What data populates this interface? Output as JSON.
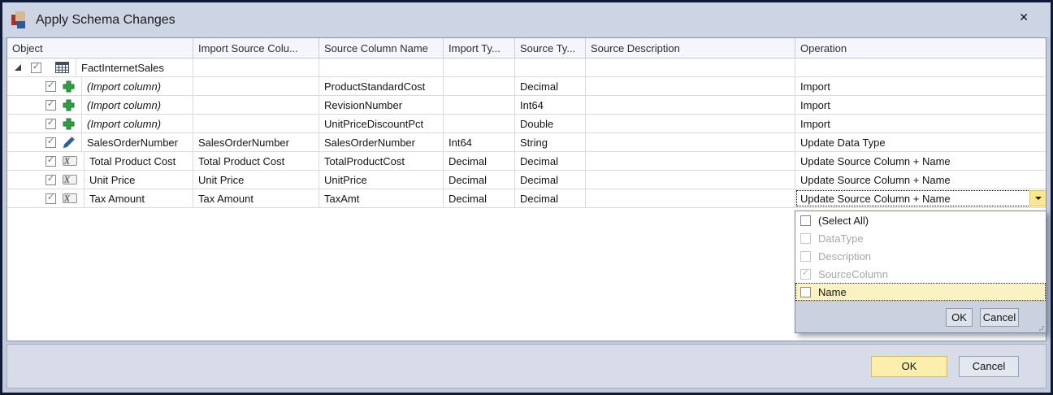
{
  "window": {
    "title": "Apply Schema Changes",
    "close_glyph": "✕"
  },
  "grid": {
    "columns": [
      {
        "label": "Object"
      },
      {
        "label": "Import Source Colu..."
      },
      {
        "label": "Source Column Name"
      },
      {
        "label": "Import Ty..."
      },
      {
        "label": "Source Ty..."
      },
      {
        "label": "Source Description"
      },
      {
        "label": "Operation"
      }
    ],
    "rows": [
      {
        "object": "FactInternetSales",
        "icon": "table-icon",
        "level": 0,
        "expanded": true,
        "checked": true,
        "import_source_column": "",
        "source_column_name": "",
        "import_type": "",
        "source_type": "",
        "source_description": "",
        "operation": ""
      },
      {
        "object": "(Import column)",
        "icon": "add-icon",
        "italic": true,
        "level": 1,
        "checked": true,
        "import_source_column": "",
        "source_column_name": "ProductStandardCost",
        "import_type": "",
        "source_type": "Decimal",
        "source_description": "",
        "operation": "Import"
      },
      {
        "object": "(Import column)",
        "icon": "add-icon",
        "italic": true,
        "level": 1,
        "checked": true,
        "import_source_column": "",
        "source_column_name": "RevisionNumber",
        "import_type": "",
        "source_type": "Int64",
        "source_description": "",
        "operation": "Import"
      },
      {
        "object": "(Import column)",
        "icon": "add-icon",
        "italic": true,
        "level": 1,
        "checked": true,
        "import_source_column": "",
        "source_column_name": "UnitPriceDiscountPct",
        "import_type": "",
        "source_type": "Double",
        "source_description": "",
        "operation": "Import"
      },
      {
        "object": "SalesOrderNumber",
        "icon": "edit-icon",
        "level": 1,
        "checked": true,
        "import_source_column": "SalesOrderNumber",
        "source_column_name": "SalesOrderNumber",
        "import_type": "Int64",
        "source_type": "String",
        "source_description": "",
        "operation": "Update Data Type"
      },
      {
        "object": "Total Product Cost",
        "icon": "column-icon",
        "level": 1,
        "checked": true,
        "import_source_column": "Total Product Cost",
        "source_column_name": "TotalProductCost",
        "import_type": "Decimal",
        "source_type": "Decimal",
        "source_description": "",
        "operation": "Update Source Column + Name"
      },
      {
        "object": "Unit Price",
        "icon": "column-icon",
        "level": 1,
        "checked": true,
        "import_source_column": "Unit Price",
        "source_column_name": "UnitPrice",
        "import_type": "Decimal",
        "source_type": "Decimal",
        "source_description": "",
        "operation": "Update Source Column + Name"
      },
      {
        "object": "Tax Amount",
        "icon": "column-icon",
        "level": 1,
        "checked": true,
        "import_source_column": "Tax Amount",
        "source_column_name": "TaxAmt",
        "import_type": "Decimal",
        "source_type": "Decimal",
        "source_description": "",
        "operation": "Update Source Column + Name",
        "operation_editor_open": true
      }
    ]
  },
  "operation_dropdown": {
    "selected_value": "Update Source Column + Name",
    "items": [
      {
        "label": "(Select All)",
        "checked": false,
        "disabled": false,
        "highlighted": false
      },
      {
        "label": "DataType",
        "checked": false,
        "disabled": true,
        "highlighted": false
      },
      {
        "label": "Description",
        "checked": false,
        "disabled": true,
        "highlighted": false
      },
      {
        "label": "SourceColumn",
        "checked": true,
        "disabled": true,
        "highlighted": false
      },
      {
        "label": "Name",
        "checked": false,
        "disabled": false,
        "highlighted": true
      }
    ],
    "ok_label": "OK",
    "cancel_label": "Cancel"
  },
  "footer": {
    "ok_label": "OK",
    "cancel_label": "Cancel"
  },
  "colors": {
    "titlebar_bg": "#cdd4e3",
    "highlight_yellow": "#fbf2c4",
    "combo_button_yellow": "#fce78f",
    "default_button_bg": "#fcefad",
    "default_button_border": "#dcba5e",
    "add_icon_green": "#2f9e44",
    "edit_icon_blue": "#2d5fa6"
  }
}
